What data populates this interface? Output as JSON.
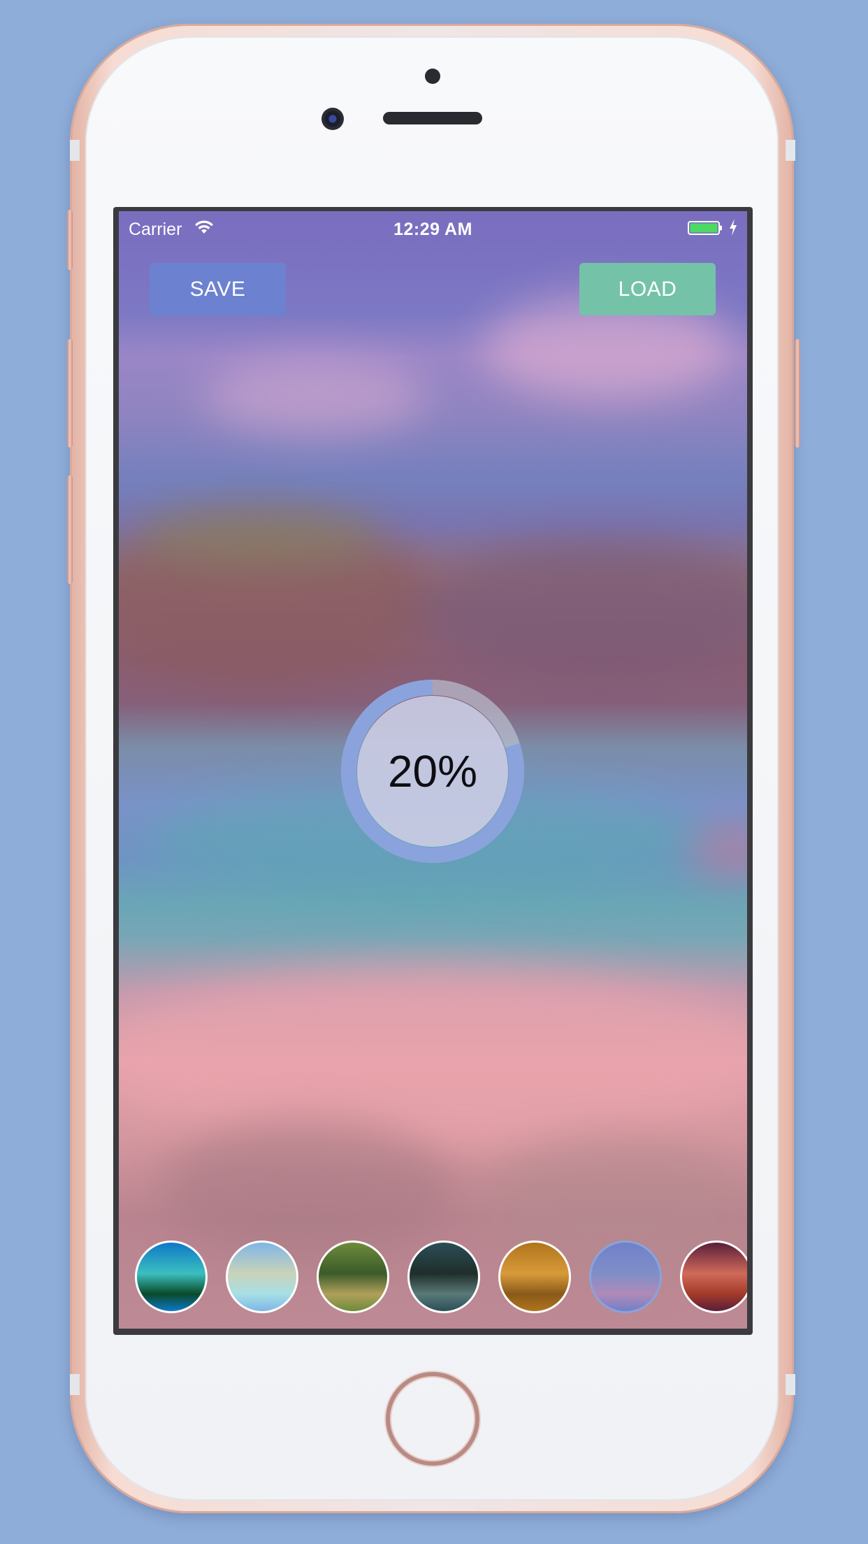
{
  "status_bar": {
    "carrier": "Carrier",
    "time": "12:29 AM",
    "wifi_icon": "wifi-icon",
    "battery_icon": "battery-charging-icon"
  },
  "actions": {
    "save_label": "SAVE",
    "load_label": "LOAD"
  },
  "progress": {
    "label": "20%",
    "value": 0.2
  },
  "filters": {
    "selected_index": 5,
    "items": [
      {
        "colors": [
          "#0e78c8",
          "#0a4a2a",
          "#3bbfbf"
        ]
      },
      {
        "colors": [
          "#7fb6e6",
          "#a7dfe6",
          "#c9d3b8"
        ]
      },
      {
        "colors": [
          "#6e8b3a",
          "#b0a05a",
          "#3b5b2a"
        ]
      },
      {
        "colors": [
          "#2b4e58",
          "#5a7a78",
          "#1f2e2a"
        ]
      },
      {
        "colors": [
          "#b0741c",
          "#8a5a1a",
          "#d89a3a"
        ]
      },
      {
        "colors": [
          "#7180c8",
          "#b08ab8",
          "#7e8fc8"
        ]
      },
      {
        "colors": [
          "#5a1e3a",
          "#a33a2a",
          "#d06a5a"
        ]
      }
    ]
  },
  "colors": {
    "save_button": "#6c81cf",
    "load_button": "#74c3a9",
    "progress_track": "#c0c6d6",
    "progress_fill": "#8aa3dc",
    "progress_center": "#c9cbe3"
  }
}
